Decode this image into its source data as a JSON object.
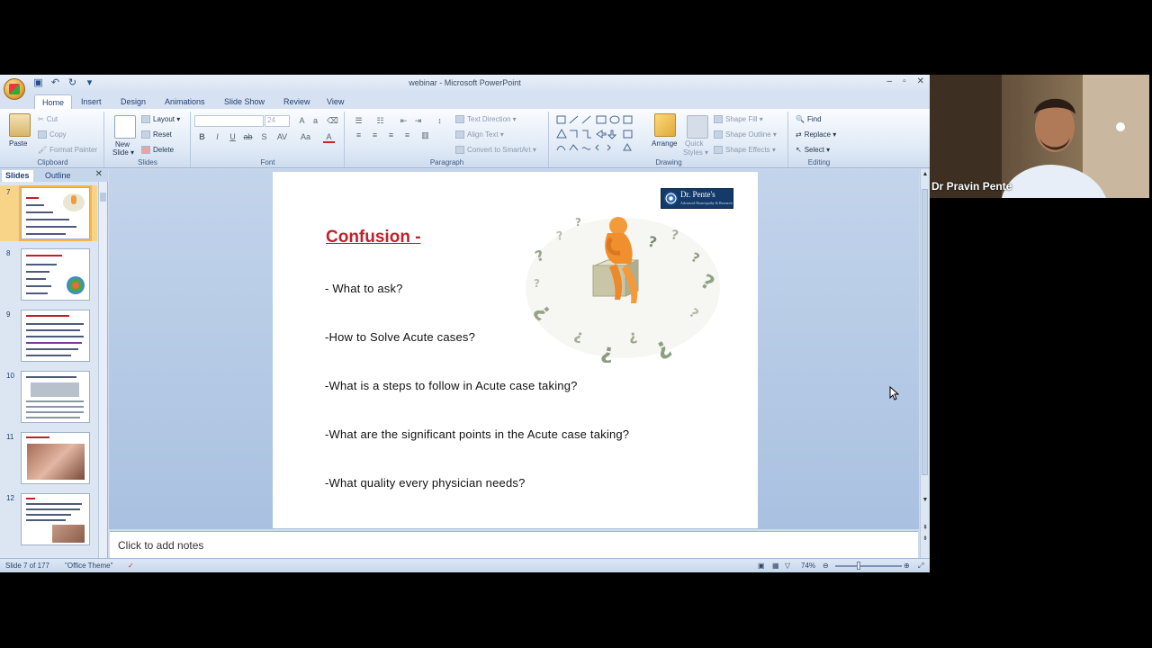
{
  "window": {
    "title": "webinar - Microsoft PowerPoint",
    "minimize": "–",
    "restore": "▫",
    "close": "✕"
  },
  "tabs": [
    "Home",
    "Insert",
    "Design",
    "Animations",
    "Slide Show",
    "Review",
    "View"
  ],
  "ribbon": {
    "clipboard": {
      "label": "Clipboard",
      "paste": "Paste",
      "cut": "Cut",
      "copy": "Copy",
      "format_painter": "Format Painter"
    },
    "slides": {
      "label": "Slides",
      "new_slide_1": "New",
      "new_slide_2": "Slide ▾",
      "layout": "Layout ▾",
      "reset": "Reset",
      "delete": "Delete"
    },
    "font": {
      "label": "Font",
      "size": "24"
    },
    "paragraph": {
      "label": "Paragraph",
      "text_direction": "Text Direction ▾",
      "align_text": "Align Text ▾",
      "convert_smartart": "Convert to SmartArt ▾"
    },
    "drawing": {
      "label": "Drawing",
      "arrange": "Arrange",
      "quick_styles_1": "Quick",
      "quick_styles_2": "Styles ▾",
      "shape_fill": "Shape Fill ▾",
      "shape_outline": "Shape Outline ▾",
      "shape_effects": "Shape Effects ▾"
    },
    "editing": {
      "label": "Editing",
      "find": "Find",
      "replace": "Replace ▾",
      "select": "Select ▾"
    }
  },
  "slides_pane": {
    "tab_slides": "Slides",
    "tab_outline": "Outline",
    "close": "✕",
    "thumbnails": [
      {
        "num": "7",
        "selected": true
      },
      {
        "num": "8",
        "selected": false
      },
      {
        "num": "9",
        "selected": false
      },
      {
        "num": "10",
        "selected": false
      },
      {
        "num": "11",
        "selected": false
      },
      {
        "num": "12",
        "selected": false
      }
    ]
  },
  "slide": {
    "logo_name": "Dr. Pente's",
    "logo_tagline": "Advanced Homeopathy & Research",
    "title": "Confusion -",
    "bullets": [
      "- What  to ask?",
      " -How to Solve Acute cases?",
      "-What is a steps to follow in  Acute case taking?",
      "-What are the significant points in the Acute case taking?",
      "-What quality every physician needs?"
    ]
  },
  "notes_placeholder": "Click to add notes",
  "status_bar": {
    "slide_counter": "Slide 7 of 177",
    "theme": "\"Office Theme\"",
    "zoom": "74%"
  },
  "webcam": {
    "name": "Dr Pravin Pente"
  },
  "colors": {
    "title_red": "#c0202a",
    "ribbon_blue": "#dfe9f6",
    "selected_thumb": "#f7d488"
  }
}
